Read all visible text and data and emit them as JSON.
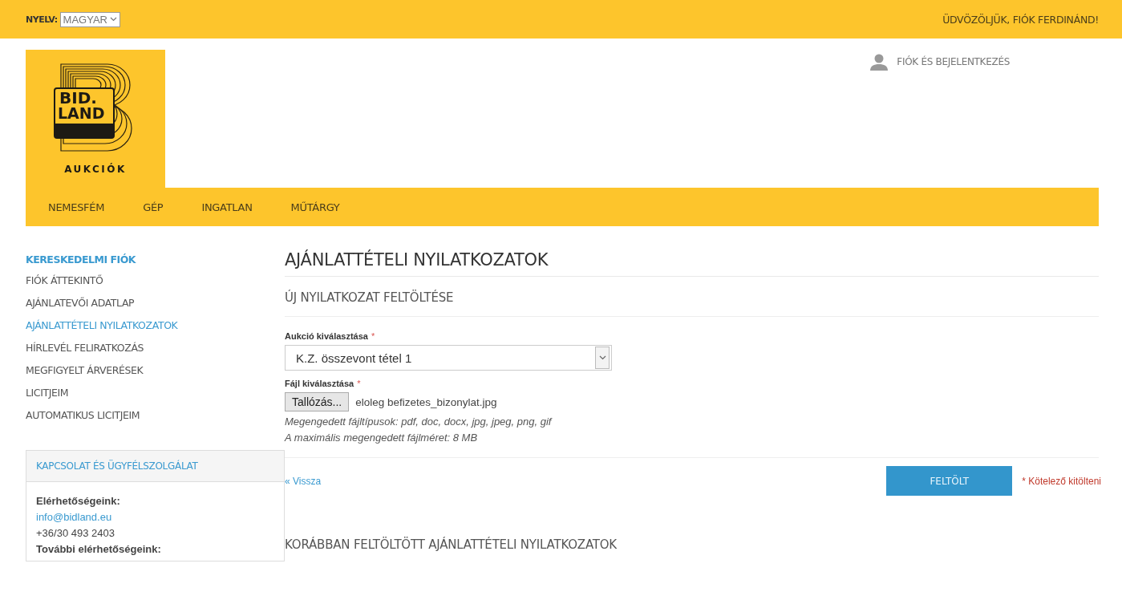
{
  "top_bar": {
    "language_label": "NYELV:",
    "language_value": "MAGYAR",
    "welcome": "ÜDVÖZÖLJÜK, FIÓK FERDINÁND!"
  },
  "logo": {
    "line_1": "BID.",
    "line_2": "LAND",
    "caption": "AUKCIÓK"
  },
  "account_link": "FIÓK ÉS BEJELENTKEZÉS",
  "nav": [
    "NEMESFÉM",
    "GÉP",
    "INGATLAN",
    "MŰTÁRGY"
  ],
  "sidebar": {
    "heading": "KERESKEDELMI FIÓK",
    "items": [
      {
        "label": "FIÓK ÁTTEKINTŐ",
        "selected": false
      },
      {
        "label": "AJÁNLATEVŐI ADATLAP",
        "selected": false
      },
      {
        "label": "AJÁNLATTÉTELI NYILATKOZATOK",
        "selected": true
      },
      {
        "label": "HÍRLEVÉL FELIRATKOZÁS",
        "selected": false
      },
      {
        "label": "MEGFIGYELT ÁRVERÉSEK",
        "selected": false
      },
      {
        "label": "LICITJEIM",
        "selected": false
      },
      {
        "label": "AUTOMATIKUS LICITJEIM",
        "selected": false
      }
    ],
    "contact": {
      "title": "KAPCSOLAT ÉS ÜGYFÉLSZOLGÁLAT",
      "lines": [
        {
          "kind": "bold",
          "text": "Elérhetőségeink:"
        },
        {
          "kind": "link",
          "text": "info@bidland.eu"
        },
        {
          "kind": "plain",
          "text": "+36/30 493 2403"
        },
        {
          "kind": "bold",
          "text": "További elérhetőségeink:"
        }
      ]
    }
  },
  "main": {
    "title": "AJÁNLATTÉTELI NYILATKOZATOK",
    "subtitle": "ÚJ NYILATKOZAT FELTÖLTÉSE",
    "auction_field": {
      "label": "Aukció kiválasztása",
      "required_mark": "*",
      "value": "K.Z. összevont tétel 1"
    },
    "file_field": {
      "label": "Fájl kiválasztása",
      "required_mark": "*",
      "button": "Tallózás...",
      "value": "eloleg befizetes_bizonylat.jpg"
    },
    "hints": [
      "Megengedett fájltípusok: pdf, doc, docx, jpg, jpeg, png, gif",
      "A maximális megengedett fájlméret: 8 MB"
    ],
    "back_link": "« Vissza",
    "submit": "FELTÖLT",
    "required_note": "* Kötelező kitölteni",
    "previous_heading": "KORÁBBAN FELTÖLTÖTT AJÁNLATTÉTELI NYILATKOZATOK"
  }
}
